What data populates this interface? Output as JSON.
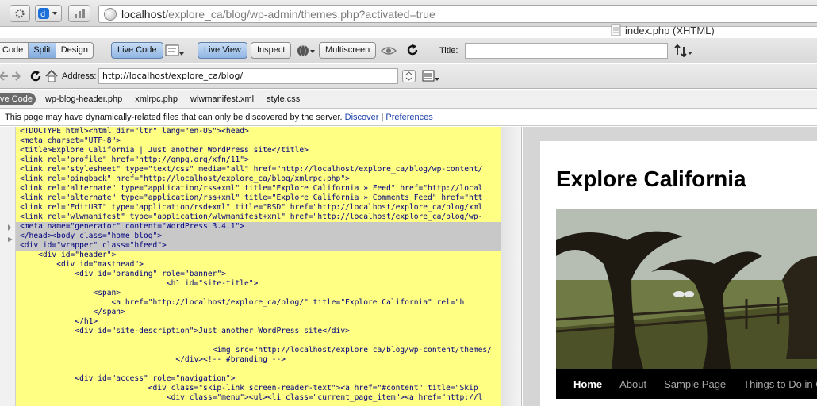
{
  "browser": {
    "url_host": "localhost",
    "url_path": "/explore_ca/blog/wp-admin/themes.php?activated=true",
    "doc_title": "index.php (XHTML)"
  },
  "toolbar1": {
    "code": "Code",
    "split": "Split",
    "design": "Design",
    "live_code": "Live Code",
    "live_view": "Live View",
    "inspect": "Inspect",
    "multiscreen": "Multiscreen",
    "title_label": "Title:",
    "title_value": ""
  },
  "toolbar2": {
    "address_label": "Address:",
    "address_value": "http://localhost/explore_ca/blog/"
  },
  "related": {
    "source_tab": "ve Code",
    "files": [
      "wp-blog-header.php",
      "xmlrpc.php",
      "wlwmanifest.xml",
      "style.css"
    ]
  },
  "info": {
    "message": "This page may have dynamically-related files that can only be discovered by the server.",
    "discover": "Discover",
    "separator": "|",
    "preferences": "Preferences"
  },
  "code_lines": [
    "<!DOCTYPE html><html dir=\"ltr\" lang=\"en-US\"><head>",
    "<meta charset=\"UTF-8\">",
    "<title>Explore California | Just another WordPress site</title>",
    "<link rel=\"profile\" href=\"http://gmpg.org/xfn/11\">",
    "<link rel=\"stylesheet\" type=\"text/css\" media=\"all\" href=\"http://localhost/explore_ca/blog/wp-content/",
    "<link rel=\"pingback\" href=\"http://localhost/explore_ca/blog/xmlrpc.php\">",
    "<link rel=\"alternate\" type=\"application/rss+xml\" title=\"Explore California » Feed\" href=\"http://local",
    "<link rel=\"alternate\" type=\"application/rss+xml\" title=\"Explore California » Comments Feed\" href=\"htt",
    "<link rel=\"EditURI\" type=\"application/rsd+xml\" title=\"RSD\" href=\"http://localhost/explore_ca/blog/xml",
    "<link rel=\"wlwmanifest\" type=\"application/wlwmanifest+xml\" href=\"http://localhost/explore_ca/blog/wp-",
    "<meta name=\"generator\" content=\"WordPress 3.4.1\">",
    "</head><body class=\"home blog\">",
    "<div id=\"wrapper\" class=\"hfeed\">",
    "    <div id=\"header\">",
    "        <div id=\"masthead\">",
    "            <div id=\"branding\" role=\"banner\">",
    "                                <h1 id=\"site-title\">",
    "                <span>",
    "                    <a href=\"http://localhost/explore_ca/blog/\" title=\"Explore California\" rel=\"h",
    "                </span>",
    "            </h1>",
    "            <div id=\"site-description\">Just another WordPress site</div>",
    "",
    "                                          <img src=\"http://localhost/explore_ca/blog/wp-content/themes/",
    "                                  </div><!-- #branding -->",
    "",
    "            <div id=\"access\" role=\"navigation\">",
    "                            <div class=\"skip-link screen-reader-text\"><a href=\"#content\" title=\"Skip",
    "                                <div class=\"menu\"><ul><li class=\"current_page_item\"><a href=\"http://l"
  ],
  "live_view": {
    "site_title": "Explore California",
    "nav": [
      "Home",
      "About",
      "Sample Page",
      "Things to Do in California"
    ]
  }
}
